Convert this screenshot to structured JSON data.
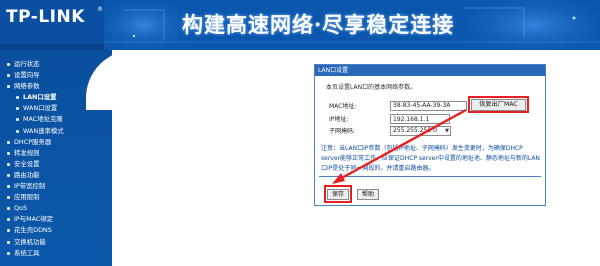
{
  "header": {
    "logo": "TP-LINK",
    "logo_mark": "®",
    "slogan": "构建高速网络·尽享稳定连接"
  },
  "sidebar": {
    "items": [
      {
        "label": "运行状态",
        "sub": false
      },
      {
        "label": "设置向导",
        "sub": false
      },
      {
        "label": "网络参数",
        "sub": false
      },
      {
        "label": "LAN口设置",
        "sub": true,
        "active": true
      },
      {
        "label": "WAN口设置",
        "sub": true
      },
      {
        "label": "MAC地址克隆",
        "sub": true
      },
      {
        "label": "WAN速率模式",
        "sub": true
      },
      {
        "label": "DHCP服务器",
        "sub": false
      },
      {
        "label": "转发规则",
        "sub": false
      },
      {
        "label": "安全设置",
        "sub": false
      },
      {
        "label": "路由功能",
        "sub": false
      },
      {
        "label": "IP带宽控制",
        "sub": false
      },
      {
        "label": "应用限制",
        "sub": false
      },
      {
        "label": "QoS",
        "sub": false
      },
      {
        "label": "IP与MAC绑定",
        "sub": false
      },
      {
        "label": "花生壳DDNS",
        "sub": false
      },
      {
        "label": "交换机功能",
        "sub": false
      },
      {
        "label": "系统工具",
        "sub": false
      }
    ]
  },
  "panel": {
    "title": "LAN口设置",
    "intro": "本页设置LAN口的基本网络参数。",
    "mac_label": "MAC地址:",
    "mac_value": "38-83-45-AA-39-3A",
    "clone_button": "恢复出厂MAC",
    "ip_label": "IP地址:",
    "ip_value": "192.168.1.1",
    "mask_label": "子网掩码:",
    "mask_value": "255.255.255.0",
    "note": "注意：当LAN口IP参数（包括IP地址、子网掩码）发生变更时，为确保DHCP server能够正常工作，应保证DHCP server中设置的地址池、静态地址与新的LAN口IP是处于同一网段的，并请重启路由器。",
    "save_button": "保存",
    "help_button": "帮助"
  },
  "colors": {
    "header_blue": "#0b4fa3",
    "panel_title_blue": "#2968b8",
    "note_blue": "#0d4aa0",
    "highlight_red": "#e62020"
  }
}
